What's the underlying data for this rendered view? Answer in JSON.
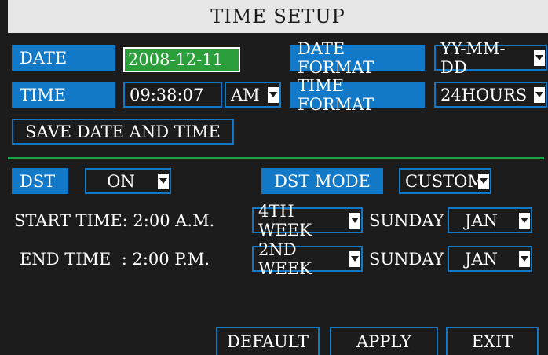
{
  "title": "TIME SETUP",
  "date": {
    "label": "DATE",
    "value": "2008-12-11"
  },
  "date_format": {
    "label": "DATE FORMAT",
    "value": "YY-MM-DD"
  },
  "time": {
    "label": "TIME",
    "value": "09:38:07",
    "ampm": "AM"
  },
  "time_format": {
    "label": "TIME FORMAT",
    "value": "24HOURS"
  },
  "save_button": "SAVE DATE AND TIME",
  "dst": {
    "label": "DST",
    "value": "ON",
    "mode_label": "DST MODE",
    "mode_value": "CUSTOM"
  },
  "start_row": {
    "label": "START TIME: 2:00 A.M.",
    "week": "4TH WEEK",
    "day": "SUNDAY",
    "month": "JAN"
  },
  "end_row": {
    "label": "END TIME  : 2:00 P.M.",
    "week": "2ND WEEK",
    "day": "SUNDAY",
    "month": "JAN"
  },
  "buttons": {
    "default": "DEFAULT",
    "apply": "APPLY",
    "exit": "EXIT"
  },
  "colors": {
    "accent": "#1278c8",
    "green": "#2b9f3c",
    "background": "#1c1c1c",
    "title_bar": "#e6e6e6"
  },
  "icons": {
    "dropdown": "chevron-down-icon"
  }
}
